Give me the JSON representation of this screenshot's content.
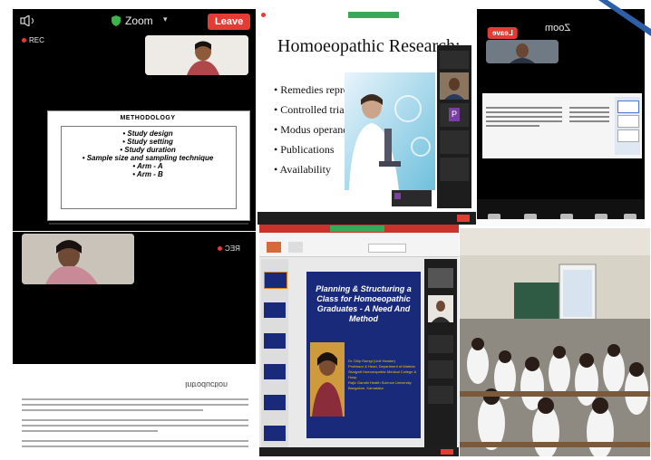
{
  "panel_top_left": {
    "app_name": "Zoom",
    "leave_label": "Leave",
    "rec_label": "REC",
    "slide_title": "METHODOLOGY",
    "slide_items": [
      "Study design",
      "Study setting",
      "Study duration",
      "Sample size and sampling technique",
      "Arm - A",
      "Arm - B"
    ]
  },
  "panel_center_top": {
    "slide_title": "Homoeopathic Research:",
    "bullets": [
      "Remedies reproven",
      "Controlled trials",
      "Modus operandii",
      "Publications",
      "Availability"
    ],
    "participant_initial": "P"
  },
  "panel_top_right": {
    "app_name": "Zoom",
    "leave_label": "Leave",
    "bottom_labels": [
      "Mute",
      "Stop Video",
      "Share",
      "Participants",
      "More"
    ]
  },
  "panel_bottom_left": {
    "rec_label": "REC",
    "doc_heading": "Introduction"
  },
  "panel_center_bottom": {
    "slide_title": "Planning & Structuring a Class for Homoeopathic Graduates - A Need And Method",
    "presenter_lines": [
      "Dr. Dilip Ramgt (Unit Header)",
      "Professor & Head, Department of Materia",
      "Sivajyoti Homoeopathic Medical College & Hosp",
      "Rajiv Gandhi Health Science University",
      "Bangalore, Karnataka"
    ]
  },
  "colors": {
    "zoom_red": "#e23c34",
    "slide_blue": "#1a2a7a",
    "slide_yellow": "#f2c318",
    "ppt_red": "#c9332b"
  }
}
